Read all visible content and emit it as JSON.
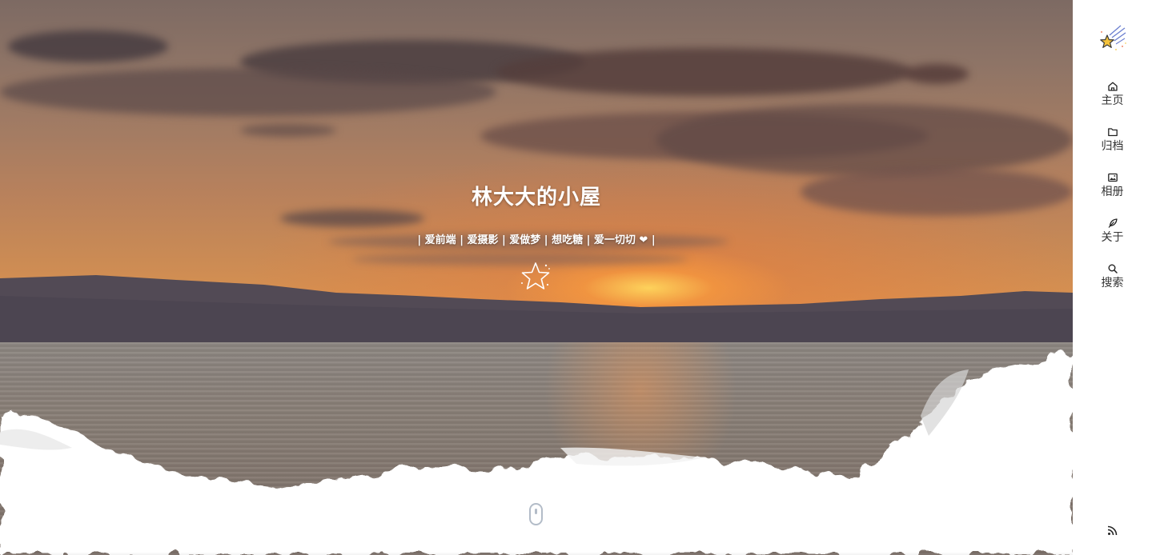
{
  "hero": {
    "title": "林大大的小屋",
    "subtitle": "| 爱前端 | 爱摄影 | 爱做梦 | 想吃糖 | 爱一切切 ❤ |",
    "star_icon": "star-icon",
    "scroll_indicator_icon": "mouse-scroll-icon"
  },
  "sidebar": {
    "logo_icon": "shooting-star-logo",
    "items": [
      {
        "label": "主页",
        "icon": "home-icon"
      },
      {
        "label": "归档",
        "icon": "folder-icon"
      },
      {
        "label": "相册",
        "icon": "image-icon"
      },
      {
        "label": "关于",
        "icon": "feather-icon"
      },
      {
        "label": "搜索",
        "icon": "search-icon"
      }
    ],
    "footer_icon": "rss-icon"
  },
  "colors": {
    "sidebar_text": "#333333",
    "hero_text": "#ffffff",
    "scroll_indicator": "#b3bcc8"
  }
}
